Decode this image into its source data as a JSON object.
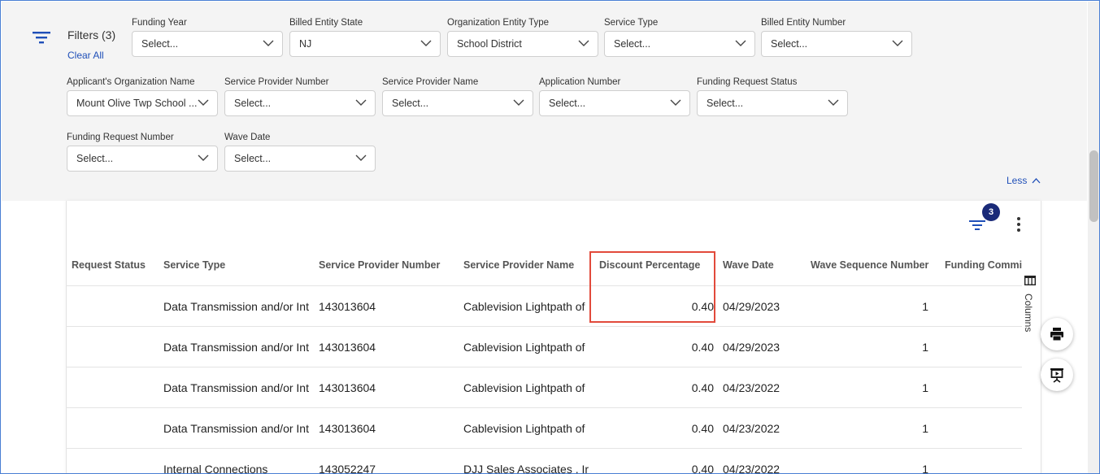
{
  "filters": {
    "title": "Filters (3)",
    "clear_all": "Clear All",
    "less": "Less",
    "fields": [
      {
        "label": "Funding Year",
        "value": "Select..."
      },
      {
        "label": "Billed Entity State",
        "value": "NJ"
      },
      {
        "label": "Organization Entity Type",
        "value": "School District"
      },
      {
        "label": "Service Type",
        "value": "Select..."
      },
      {
        "label": "Billed Entity Number",
        "value": "Select..."
      },
      {
        "label": "Applicant's Organization Name",
        "value": "Mount Olive Twp School ..."
      },
      {
        "label": "Service Provider Number",
        "value": "Select..."
      },
      {
        "label": "Service Provider Name",
        "value": "Select..."
      },
      {
        "label": "Application Number",
        "value": "Select..."
      },
      {
        "label": "Funding Request Status",
        "value": "Select..."
      },
      {
        "label": "Funding Request Number",
        "value": "Select..."
      },
      {
        "label": "Wave Date",
        "value": "Select..."
      }
    ]
  },
  "toolbar": {
    "filter_badge": "3",
    "columns_label": "Columns"
  },
  "grid": {
    "headers": [
      "Request Status",
      "Service Type",
      "Service Provider Number",
      "Service Provider Name",
      "Discount Percentage",
      "Wave Date",
      "Wave Sequence Number",
      "Funding Commi"
    ],
    "rows": [
      [
        "",
        "Data Transmission and/or Int",
        "143013604",
        "Cablevision Lightpath of",
        "0.40",
        "04/29/2023",
        "1",
        ""
      ],
      [
        "",
        "Data Transmission and/or Int",
        "143013604",
        "Cablevision Lightpath of",
        "0.40",
        "04/29/2023",
        "1",
        ""
      ],
      [
        "",
        "Data Transmission and/or Int",
        "143013604",
        "Cablevision Lightpath of",
        "0.40",
        "04/23/2022",
        "1",
        ""
      ],
      [
        "",
        "Data Transmission and/or Int",
        "143013604",
        "Cablevision Lightpath of",
        "0.40",
        "04/23/2022",
        "1",
        ""
      ],
      [
        "",
        "Internal Connections",
        "143052247",
        "DJJ Sales Associates , Ir",
        "0.40",
        "04/23/2022",
        "1",
        ""
      ]
    ]
  },
  "colors": {
    "accent": "#1f4fb8",
    "badge": "#1a2a78",
    "highlight": "#e24a3b",
    "panel_bg": "#f4f4f4"
  },
  "icons": [
    "filter-list-icon",
    "chevron-down-icon",
    "chevron-up-icon",
    "more-vertical-icon",
    "columns-icon",
    "print-icon",
    "presentation-icon"
  ]
}
